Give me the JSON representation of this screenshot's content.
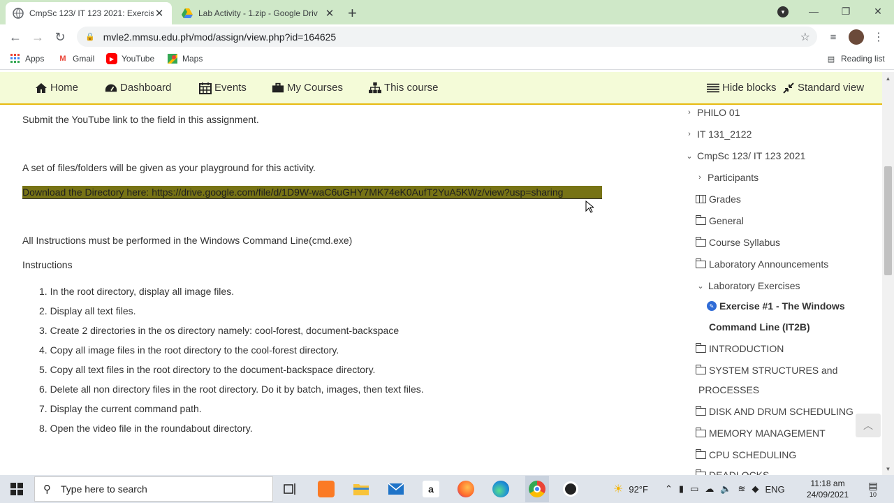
{
  "browser": {
    "tabs": [
      {
        "title": "CmpSc 123/ IT 123 2021: Exercis",
        "active": true,
        "icon": "globe-icon"
      },
      {
        "title": "Lab Activity - 1.zip - Google Driv",
        "active": false,
        "icon": "google-drive-icon"
      }
    ],
    "url": "mvle2.mmsu.edu.ph/mod/assign/view.php?id=164625",
    "bookmarks": [
      {
        "label": "Apps",
        "icon": "apps-grid-icon"
      },
      {
        "label": "Gmail",
        "icon": "gmail-icon"
      },
      {
        "label": "YouTube",
        "icon": "youtube-icon"
      },
      {
        "label": "Maps",
        "icon": "maps-icon"
      }
    ],
    "reading_list": "Reading list"
  },
  "navbar": {
    "home": "Home",
    "dashboard": "Dashboard",
    "events": "Events",
    "my_courses": "My Courses",
    "this_course": "This course",
    "hide_blocks": "Hide blocks",
    "standard_view": "Standard view"
  },
  "content": {
    "submit_note": "Submit the YouTube link to the field in this assignment.",
    "playground_note": "A set of files/folders will be given as your playground for this activity.",
    "download_link": "Download the Directory here: https://drive.google.com/file/d/1D9W-waC6uGHY7MK74eK0AufT2YuA5KWz/view?usp=sharing",
    "cmd_note": "All Instructions must be performed in the Windows Command Line(cmd.exe)",
    "instructions_heading": "Instructions",
    "steps": [
      "1. In the root directory, display all image files.",
      "2. Display all text files.",
      "3. Create 2 directories in the os directory namely: cool-forest, document-backspace",
      "4. Copy all image files in the root directory to the cool-forest directory.",
      "5. Copy all text files in the root directory to the document-backspace directory.",
      "6. Delete all non directory files in the root directory. Do it by batch, images, then text files.",
      "7. Display the current command path.",
      "8. Open the video file in the roundabout directory."
    ]
  },
  "sidebar": {
    "philo": "PHILO 01",
    "it131": "IT 131_2122",
    "course": "CmpSc 123/ IT 123 2021",
    "participants": "Participants",
    "grades": "Grades",
    "general": "General",
    "syllabus": "Course Syllabus",
    "lab_announcements": "Laboratory Announcements",
    "lab_exercises": "Laboratory Exercises",
    "exercise_line1": "Exercise #1 - The Windows",
    "exercise_line2": "Command Line (IT2B)",
    "introduction": "INTRODUCTION",
    "system_line1": "SYSTEM STRUCTURES and",
    "system_line2": "PROCESSES",
    "disk": "DISK AND DRUM SCHEDULING",
    "memory": "MEMORY MANAGEMENT",
    "cpu": "CPU SCHEDULING",
    "deadlocks": "DEADLOCKS"
  },
  "taskbar": {
    "search_placeholder": "Type here to search",
    "weather": "92°F",
    "lang": "ENG",
    "time": "11:18 am",
    "date": "24/09/2021",
    "notifications": "10"
  }
}
